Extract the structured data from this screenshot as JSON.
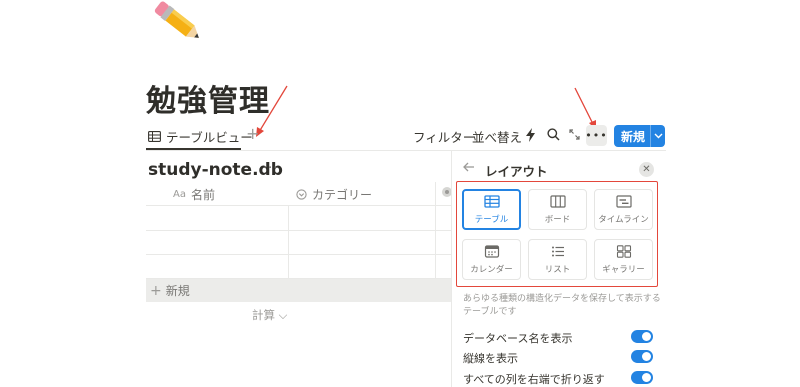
{
  "page": {
    "icon": "pencil-emoji",
    "title": "勉強管理"
  },
  "view_tabs": {
    "active_label": "テーブルビュー",
    "add_symbol": "+"
  },
  "toolbar": {
    "filter_label": "フィルター",
    "sort_label": "並べ替え",
    "more_symbol": "•••",
    "new_label": "新規",
    "new_dropdown_symbol": "⌄"
  },
  "database": {
    "title": "study-note.db",
    "more_symbol": "···",
    "columns": [
      {
        "icon_text": "Aa",
        "label": "名前"
      },
      {
        "icon": "select-icon",
        "label": "カテゴリー"
      }
    ],
    "new_row_label": "新規",
    "calc_label": "計算 ⌵"
  },
  "layout_panel": {
    "title": "レイアウト",
    "options": [
      {
        "label": "テーブル",
        "icon": "table-icon",
        "selected": true
      },
      {
        "label": "ボード",
        "icon": "board-icon",
        "selected": false
      },
      {
        "label": "タイムライン",
        "icon": "timeline-icon",
        "selected": false
      },
      {
        "label": "カレンダー",
        "icon": "calendar-icon",
        "selected": false
      },
      {
        "label": "リスト",
        "icon": "list-icon",
        "selected": false
      },
      {
        "label": "ギャラリー",
        "icon": "gallery-icon",
        "selected": false
      }
    ],
    "description": "あらゆる種類の構造化データを保存して表示するテーブルです",
    "settings": [
      {
        "label": "データベース名を表示",
        "enabled": true
      },
      {
        "label": "縦線を表示",
        "enabled": true
      },
      {
        "label": "すべての列を右端で折り返す",
        "enabled": true
      }
    ]
  },
  "colors": {
    "accent": "#2383e2",
    "annotation": "#e3473b"
  }
}
